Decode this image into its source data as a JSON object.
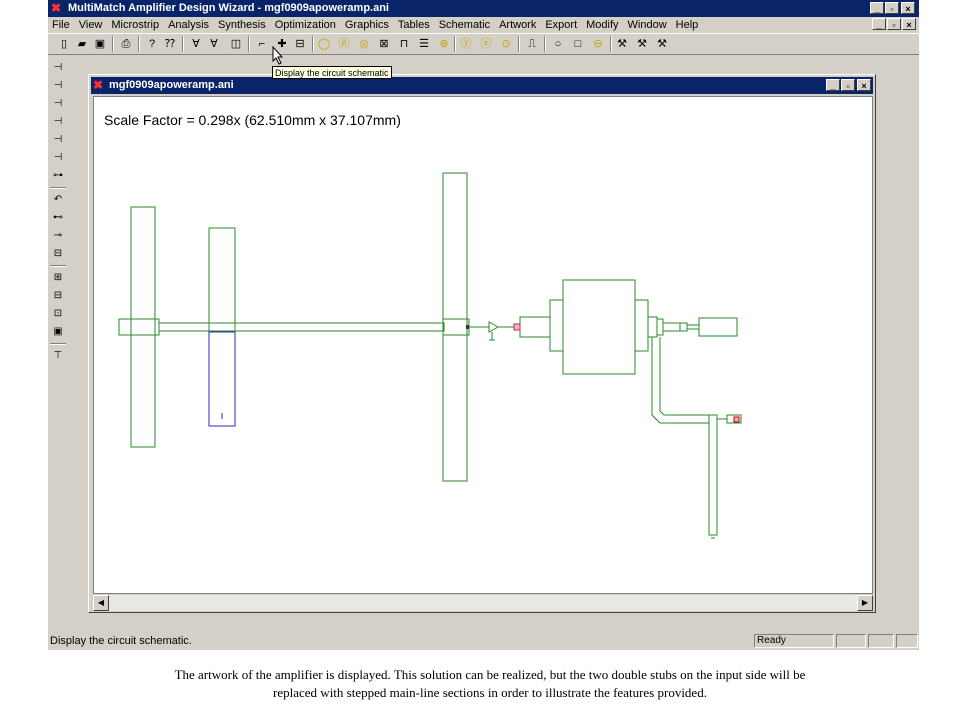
{
  "window": {
    "title": "MultiMatch Amplifier Design Wizard - mgf0909apoweramp.ani",
    "minimize": "_",
    "restore": "▫",
    "close": "×"
  },
  "menu": {
    "items": [
      "File",
      "View",
      "Microstrip",
      "Analysis",
      "Synthesis",
      "Optimization",
      "Graphics",
      "Tables",
      "Schematic",
      "Artwork",
      "Export",
      "Modify",
      "Window",
      "Help"
    ]
  },
  "toolbar": {
    "tooltip": "Display the circuit schematic"
  },
  "child": {
    "title": "mgf0909apoweramp.ani",
    "scale_text": "Scale Factor =  0.298x (62.510mm x 37.107mm)"
  },
  "statusbar": {
    "message": "Display the circuit schematic.",
    "ready": "Ready"
  },
  "caption": {
    "line1": "The artwork of the amplifier is displayed. This solution can be realized, but the two double stubs on the input side will be",
    "line2": "replaced with stepped main-line  sections in order to illustrate the features provided."
  },
  "colors": {
    "titlebar": "#0a246a",
    "chrome": "#d4d0c8",
    "artwork_green": "#2a8a2a",
    "artwork_blue": "#2b2bb0",
    "tooltip_bg": "#ffffe1"
  }
}
